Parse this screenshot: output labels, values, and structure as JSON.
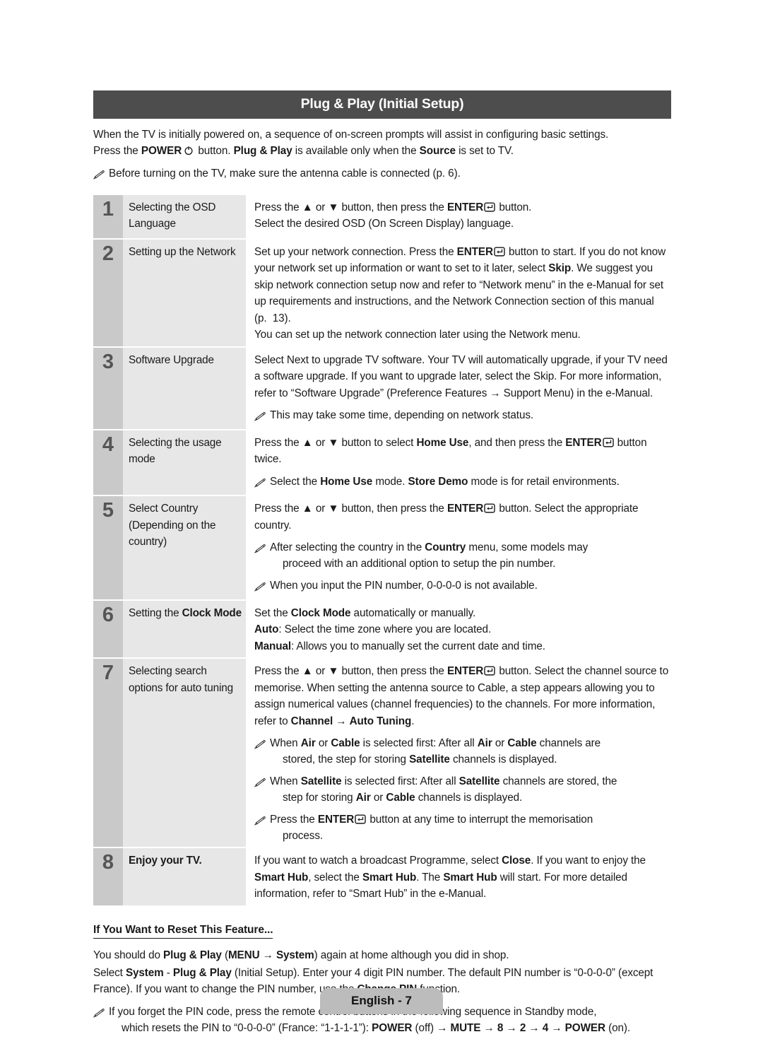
{
  "header": {
    "title": "Plug & Play (Initial Setup)"
  },
  "intro": {
    "line1": "When the TV is initially powered on, a sequence of on-screen prompts will assist in configuring basic settings.",
    "line2_a": "Press the ",
    "line2_power": "POWER",
    "line2_b": " button. ",
    "line2_pnp": "Plug & Play",
    "line2_c": " is available only when the ",
    "line2_source": "Source",
    "line2_d": " is set to TV.",
    "note": "Before turning on the TV, make sure the antenna cable is connected (p. 6)."
  },
  "steps": [
    {
      "num": "1",
      "label": "Selecting the OSD Language",
      "lines": [
        "Press the ▲ or ▼ button, then press the ENTER↵ button.",
        "Select the desired OSD (On Screen Display) language."
      ]
    },
    {
      "num": "2",
      "label": "Setting up the Network",
      "lines": [
        "Set up your network connection. Press the ENTER↵ button to start. If you do not know your network set up information or want to set to it later, select Skip. We suggest you skip network connection setup now and refer to “Network menu” in the e-Manual for set up requirements and instructions, and the Network Connection section of this manual (p. 13).",
        "You can set up the network connection later using the Network menu."
      ]
    },
    {
      "num": "3",
      "label": "Software Upgrade",
      "lines": [
        "Select Next to upgrade TV software. Your TV will automatically upgrade, if your TV need a software upgrade. If you want to upgrade later, select the Skip. For more information, refer to “Software Upgrade” (Preference Features → Support Menu) in the e-Manual."
      ],
      "notes": [
        "This may take some time, depending on network status."
      ]
    },
    {
      "num": "4",
      "label": "Selecting the usage mode",
      "lines": [
        "Press the ▲ or ▼ button to select Home Use, and then press the ENTER↵ button twice."
      ],
      "notes": [
        "Select the Home Use mode. Store Demo mode is for retail environments."
      ]
    },
    {
      "num": "5",
      "label": "Select Country (Depending on the country)",
      "lines": [
        "Press the ▲ or ▼ button, then press the ENTER↵ button. Select the appropriate country."
      ],
      "notes": [
        "After selecting the country in the Country menu, some models may proceed with an additional option to setup the pin number.",
        "When you input the PIN number, 0-0-0-0 is not available."
      ]
    },
    {
      "num": "6",
      "label": "Setting the Clock Mode",
      "lines": [
        "Set the Clock Mode automatically or manually.",
        "Auto: Select the time zone where you are located.",
        "Manual: Allows you to manually set the current date and time."
      ]
    },
    {
      "num": "7",
      "label": "Selecting search options for auto tuning",
      "lines": [
        "Press the ▲ or ▼ button, then press the ENTER↵ button. Select the channel source to memorise. When setting the antenna source to Cable, a step appears allowing you to assign numerical values (channel frequencies) to the channels. For more information, refer to Channel → Auto Tuning."
      ],
      "notes": [
        "When Air or Cable is selected first: After all Air or Cable channels are stored, the step for storing Satellite channels is displayed.",
        "When Satellite is selected first: After all Satellite channels are stored, the step for storing Air or Cable channels is displayed.",
        "Press the ENTER↵ button at any time to interrupt the memorisation process."
      ]
    },
    {
      "num": "8",
      "label": "Enjoy your TV.",
      "lines": [
        "If you want to watch a broadcast Programme, select Close. If you want to enjoy the Smart Hub, select the Smart Hub. The Smart Hub will start. For more detailed information, refer to “Smart Hub” in the e-Manual."
      ]
    }
  ],
  "reset": {
    "heading": "If You Want to Reset This Feature...",
    "p1": "You should do Plug & Play (MENU → System) again at home although you did in shop.",
    "p2": "Select System - Plug & Play (Initial Setup). Enter your 4 digit PIN number. The default PIN number is “0-0-0-0” (except France). If you want to change the PIN number, use the Change PIN function.",
    "note": "If you forget the PIN code, press the remote control buttons in the following sequence in Standby mode, which resets the PIN to “0-0-0-0” (France: “1-1-1-1”): POWER (off) → MUTE → 8 → 2 → 4 → POWER (on)."
  },
  "footer": {
    "page_label": "English - 7"
  },
  "colors": {
    "title_bar_bg": "#4d4d4d",
    "step_number_bg": "#c9c9c9",
    "step_label_bg": "#e7e7e7",
    "page_badge_bg": "#bcbcbc",
    "text": "#1a1a1a"
  }
}
